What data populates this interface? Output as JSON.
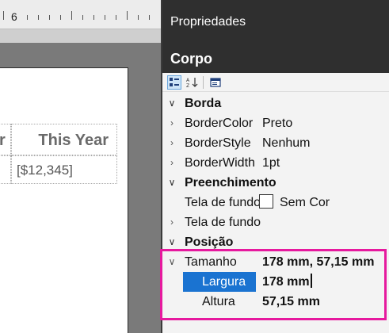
{
  "ruler": {
    "number": "6"
  },
  "table": {
    "header_partial": "r",
    "header": "This Year",
    "value": "[$12,345]"
  },
  "panel": {
    "title": "Propriedades",
    "object": "Corpo"
  },
  "toolbar": {
    "categorized_icon": "categorized-icon",
    "alphabetical_icon": "alphabetical-sort-icon",
    "pages_icon": "property-pages-icon"
  },
  "properties": {
    "borda": {
      "label": "Borda",
      "items": [
        {
          "label": "BorderColor",
          "value": "Preto"
        },
        {
          "label": "BorderStyle",
          "value": "Nenhum"
        },
        {
          "label": "BorderWidth",
          "value": "1pt"
        }
      ]
    },
    "preenchimento": {
      "label": "Preenchimento",
      "items": [
        {
          "label": "Tela de fundo",
          "value": "Sem Cor"
        },
        {
          "label": "Tela de fundo",
          "value": ""
        }
      ]
    },
    "posicao": {
      "label": "Posição",
      "tamanho": {
        "label": "Tamanho",
        "value": "178 mm, 57,15 mm"
      },
      "largura": {
        "label": "Largura",
        "value": "178 mm"
      },
      "altura": {
        "label": "Altura",
        "value": "57,15 mm"
      }
    }
  },
  "colors": {
    "highlight": "#e6199e",
    "selection": "#1a73d1",
    "panel_header": "#2f2f2f"
  }
}
